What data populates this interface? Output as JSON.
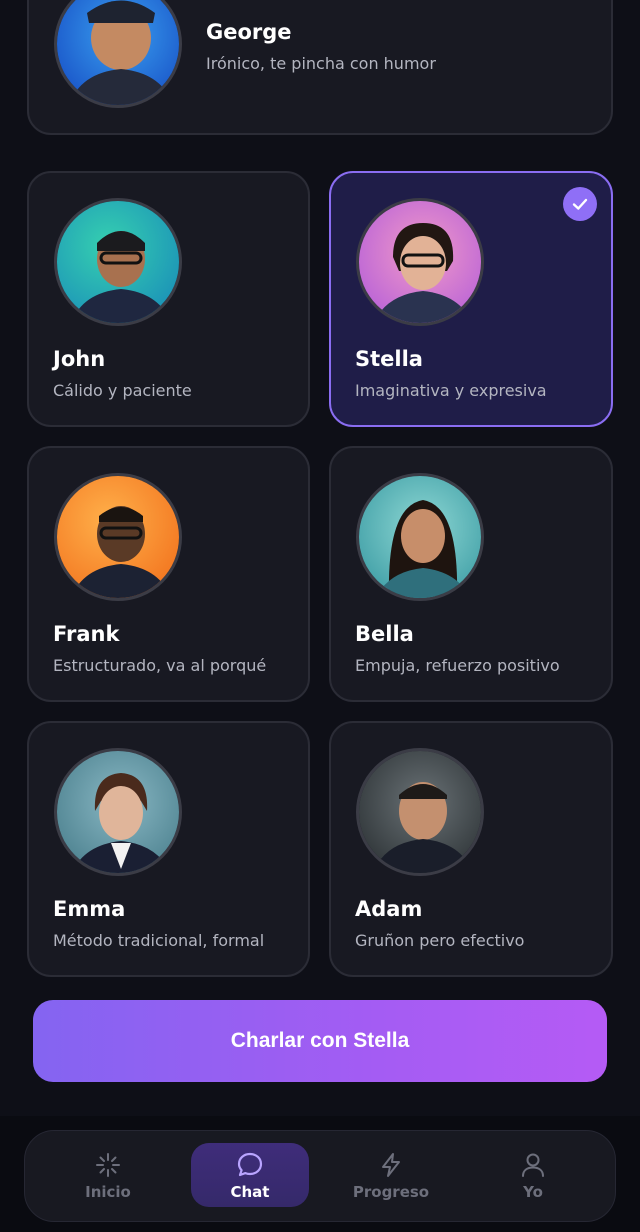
{
  "tutors": [
    {
      "name": "George",
      "description": "Irónico, te pincha con humor"
    },
    {
      "name": "John",
      "description": "Cálido y paciente"
    },
    {
      "name": "Stella",
      "description": "Imaginativa y expresiva",
      "selected": true
    },
    {
      "name": "Frank",
      "description": "Estructurado, va al porqué"
    },
    {
      "name": "Bella",
      "description": "Empuja, refuerzo positivo"
    },
    {
      "name": "Emma",
      "description": "Método tradicional, formal"
    },
    {
      "name": "Adam",
      "description": "Gruñon pero efectivo"
    }
  ],
  "cta": {
    "label": "Charlar con Stella"
  },
  "nav": {
    "items": [
      {
        "label": "Inicio",
        "icon": "sparkle-icon"
      },
      {
        "label": "Chat",
        "icon": "chat-bubble-icon",
        "active": true
      },
      {
        "label": "Progreso",
        "icon": "lightning-icon"
      },
      {
        "label": "Yo",
        "icon": "user-icon"
      }
    ]
  },
  "colors": {
    "background": "#0e0f17",
    "card": "#181922",
    "selected_card": "#1f1d48",
    "accent": "#8f6ff6",
    "cta_gradient_start": "#8464f1",
    "cta_gradient_end": "#b55bf5"
  }
}
